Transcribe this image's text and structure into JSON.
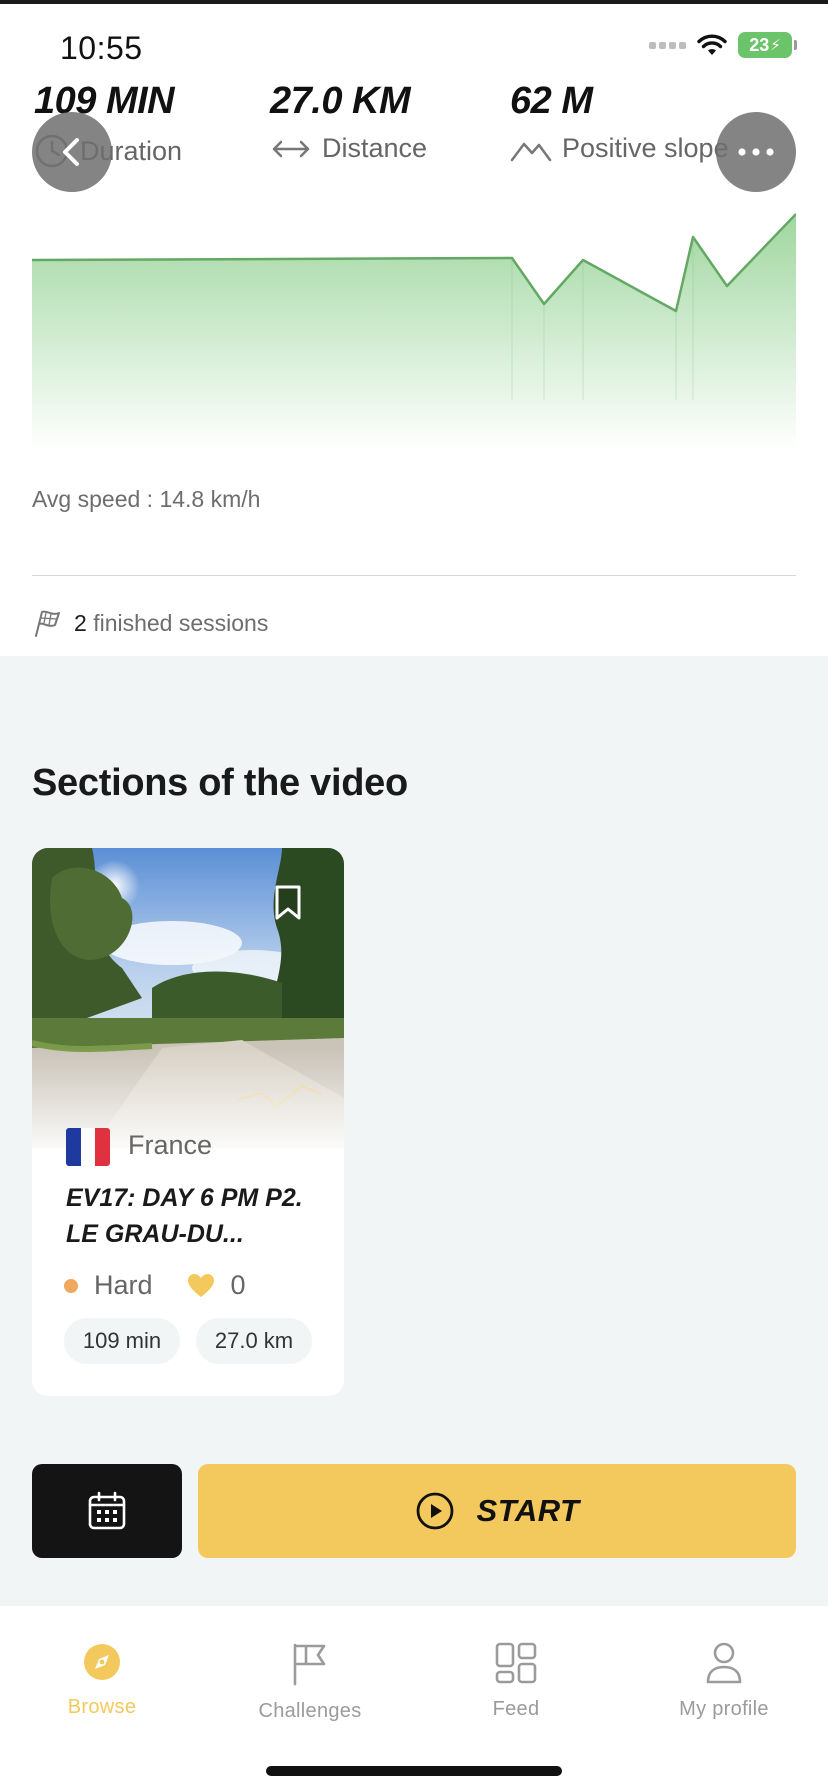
{
  "status_bar": {
    "time": "10:55",
    "battery": "23"
  },
  "stats": [
    {
      "value": "109 MIN",
      "label": "Duration",
      "icon": "clock-icon"
    },
    {
      "value": "27.0 KM",
      "label": "Distance",
      "icon": "horizontal-arrows-icon"
    },
    {
      "value": "62 M",
      "label": "Positive slope",
      "icon": "mountain-icon"
    }
  ],
  "header_buttons": {
    "back_icon": "chevron-left-icon",
    "more_icon": "more-dots-icon"
  },
  "elevation_profile": {
    "fill_color": "#8fcf8f",
    "line_color": "#63a863"
  },
  "avg_speed": "Avg speed : 14.8 km/h",
  "sessions": {
    "count": "2",
    "label": "finished sessions"
  },
  "sections": {
    "title": "Sections of the video",
    "cards": [
      {
        "country": "France",
        "title": "EV17: DAY 6 PM P2. LE GRAU-DU...",
        "difficulty": "Hard",
        "difficulty_color": "#f0a85c",
        "likes": "0",
        "duration": "109 min",
        "distance": "27.0 km"
      }
    ]
  },
  "actions": {
    "start_label": "START"
  },
  "tabbar": {
    "items": [
      {
        "label": "Browse",
        "icon": "compass-icon",
        "active": true
      },
      {
        "label": "Challenges",
        "icon": "flag-icon",
        "active": false
      },
      {
        "label": "Feed",
        "icon": "grid-icon",
        "active": false
      },
      {
        "label": "My profile",
        "icon": "person-icon",
        "active": false
      }
    ]
  },
  "colors": {
    "accent": "#f3c95d",
    "dark_button": "#141414",
    "section_bg": "#f2f5f6"
  }
}
